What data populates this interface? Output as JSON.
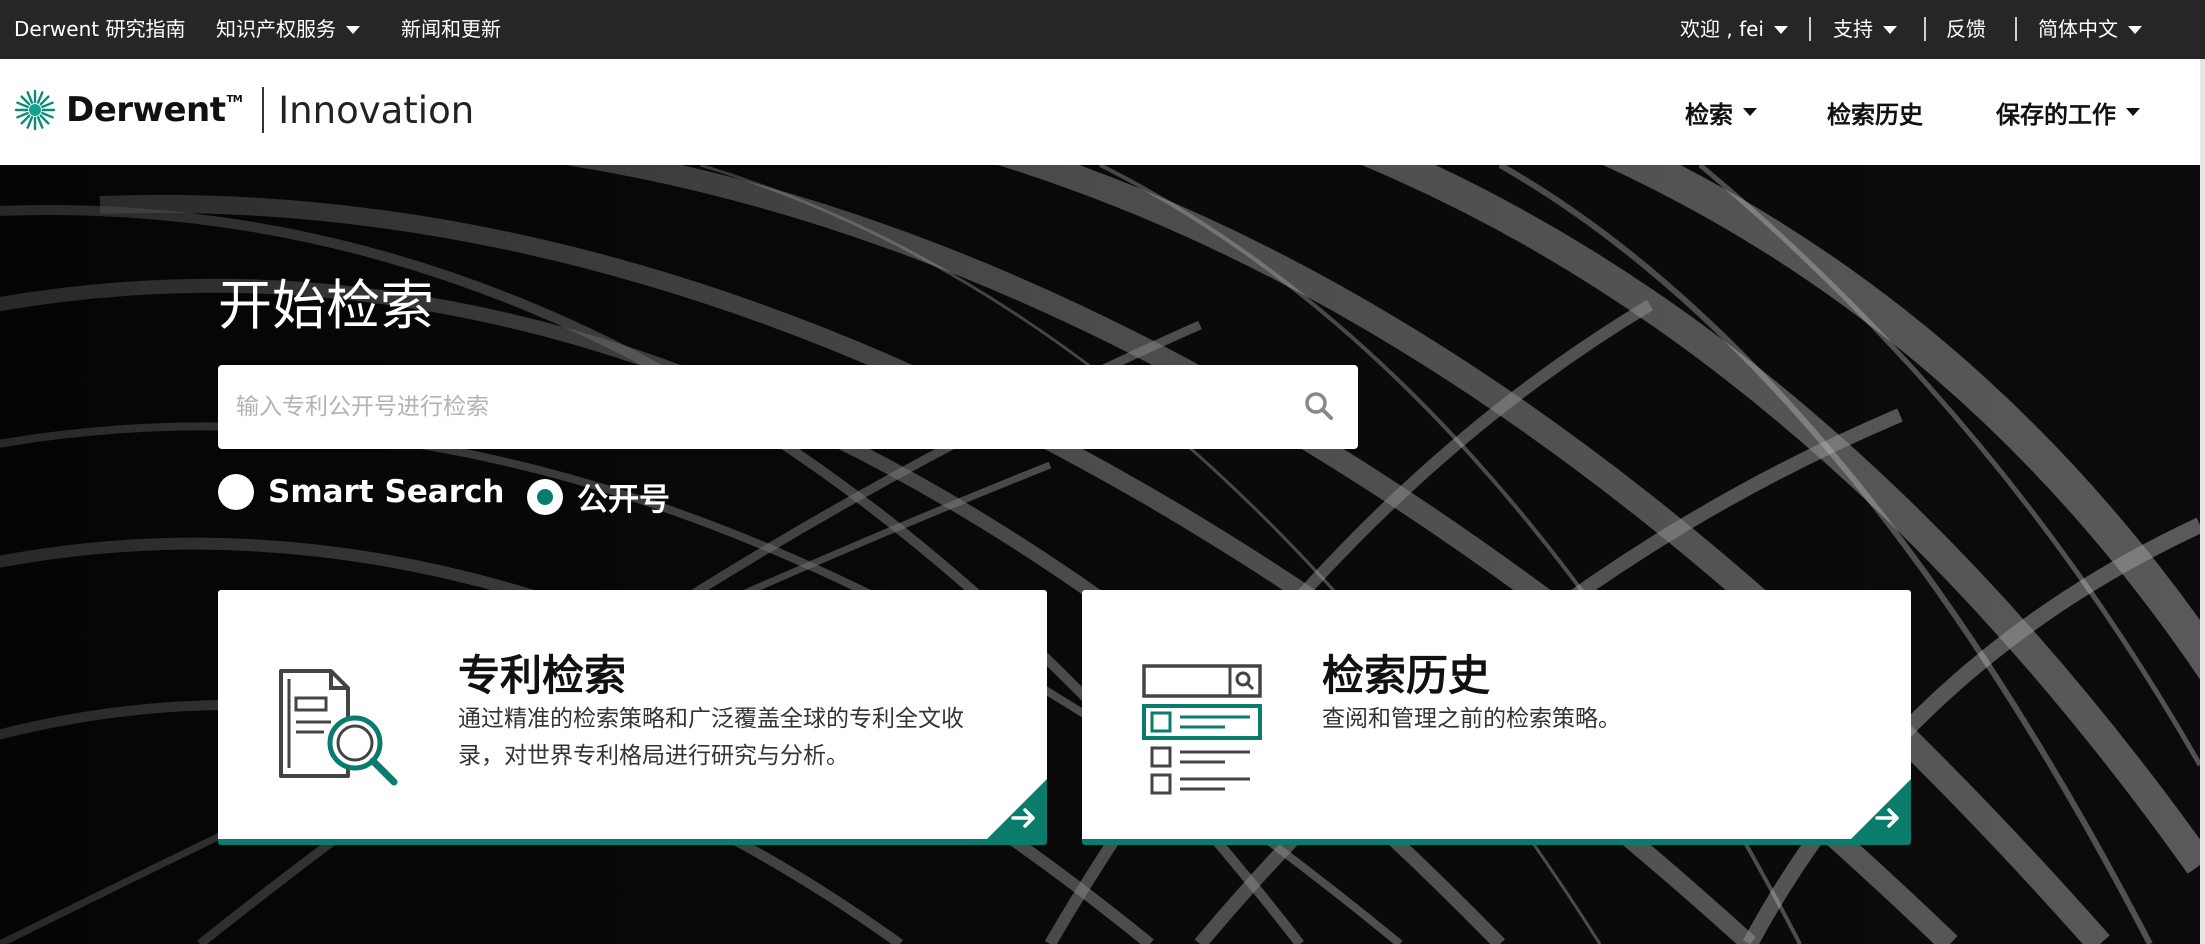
{
  "topbar": {
    "guide": "Derwent 研究指南",
    "ip_services": "知识产权服务",
    "news": "新闻和更新",
    "welcome": "欢迎 , fei",
    "support": "支持",
    "feedback": "反馈",
    "language": "简体中文"
  },
  "brand": {
    "name": "Derwent",
    "tm": "TM",
    "product": "Innovation"
  },
  "nav": {
    "search": "检索",
    "history": "检索历史",
    "saved": "保存的工作"
  },
  "hero": {
    "title": "开始检索",
    "search_placeholder": "输入专利公开号进行检索",
    "options": [
      {
        "label": "Smart Search",
        "selected": false
      },
      {
        "label": "公开号",
        "selected": true
      }
    ]
  },
  "cards": [
    {
      "title": "专利检索",
      "desc": "通过精准的检索策略和广泛覆盖全球的专利全文收录，对世界专利格局进行研究与分析。",
      "icon": "patent-search-icon"
    },
    {
      "title": "检索历史",
      "desc": "查阅和管理之前的检索策略。",
      "icon": "search-history-icon"
    }
  ],
  "colors": {
    "topbar": "#262626",
    "accent": "#0a7c6c",
    "card_bg": "#ffffff"
  }
}
